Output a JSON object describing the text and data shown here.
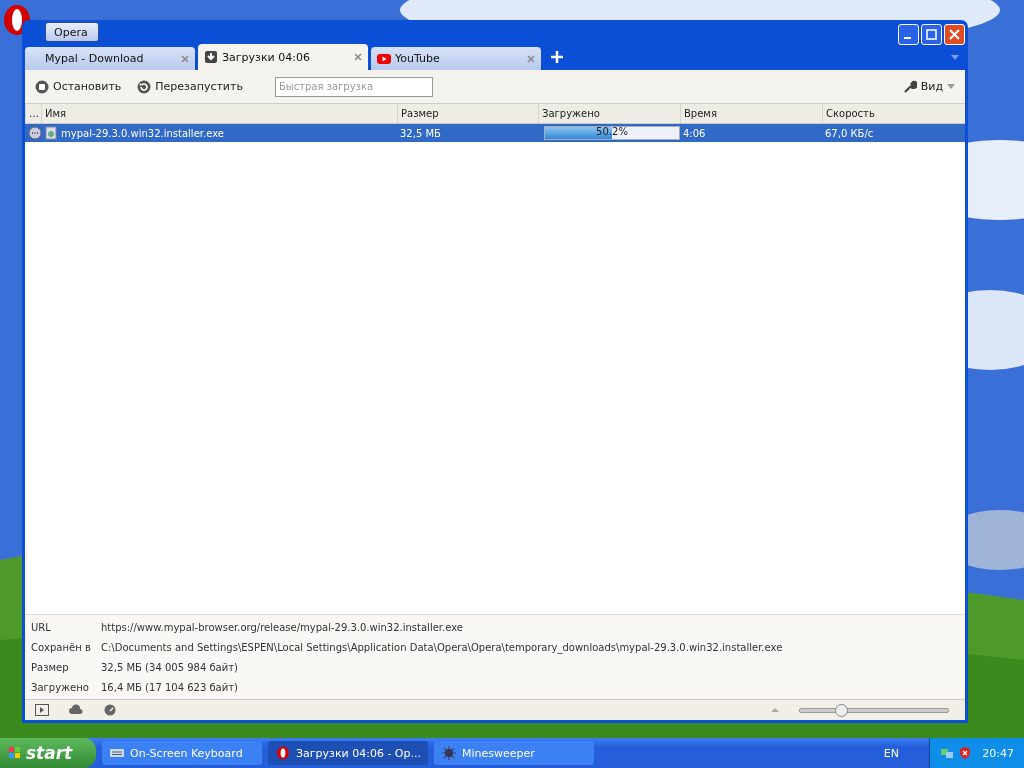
{
  "window": {
    "menu_button": "Opera"
  },
  "tabs": [
    {
      "label": "Mypal - Download",
      "selected": false
    },
    {
      "label": "Загрузки 04:06",
      "selected": true
    },
    {
      "label": "YouTube",
      "selected": false
    }
  ],
  "toolbar": {
    "buttons": [
      "Остановить",
      "Перезапустить"
    ],
    "quick_download": {
      "placeholder": "Быстрая загрузка"
    },
    "view_button": "Вид"
  },
  "table": {
    "columns": [
      "…",
      "Имя",
      "Размер",
      "Загружено",
      "Время",
      "Скорость"
    ],
    "rows": [
      {
        "name": "mypal-29.3.0.win32.installer.exe",
        "size": "32,5 МБ",
        "progress": {
          "level": 0.503,
          "text": "50.2%"
        },
        "time": "4:06",
        "speed": "67,0 КБ/с",
        "selected": true
      }
    ]
  },
  "details": [
    {
      "label": "URL",
      "value": "https://www.mypal-browser.org/release/mypal-29.3.0.win32.installer.exe"
    },
    {
      "label": "Сохранён в",
      "value": "C:\\Documents and Settings\\ESPEN\\Local Settings\\Application Data\\Opera\\Opera\\temporary_downloads\\mypal-29.3.0.win32.installer.exe"
    },
    {
      "label": "Размер",
      "value": "32,5 МБ (34 005 984 байт)"
    },
    {
      "label": "Загружено",
      "value": "16,4 МБ (17 104 623 байт)"
    }
  ],
  "status_bar": {
    "zoom": {
      "level": 0.28
    }
  },
  "taskbar": {
    "start": "start",
    "items": [
      {
        "label": "On-Screen Keyboard",
        "selected": false
      },
      {
        "label": "Загрузки 04:06 - Op...",
        "selected": true
      },
      {
        "label": "Minesweeper",
        "selected": false
      }
    ],
    "language": "EN",
    "clock": "20:47"
  }
}
